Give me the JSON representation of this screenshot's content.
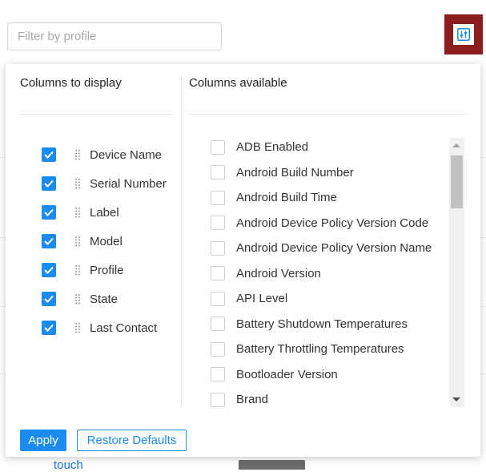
{
  "filter": {
    "placeholder": "Filter by profile"
  },
  "toolbar": {
    "column_settings_icon": "sliders-icon",
    "active_color": "#8c1d1f"
  },
  "background": {
    "link_text": "touch"
  },
  "panel": {
    "left_title": "Columns to display",
    "right_title": "Columns available",
    "selected_columns": [
      "Device Name",
      "Serial Number",
      "Label",
      "Model",
      "Profile",
      "State",
      "Last Contact"
    ],
    "available_columns": [
      "ADB Enabled",
      "Android Build Number",
      "Android Build Time",
      "Android Device Policy Version Code",
      "Android Device Policy Version Name",
      "Android Version",
      "API Level",
      "Battery Shutdown Temperatures",
      "Battery Throttling Temperatures",
      "Bootloader Version",
      "Brand"
    ],
    "apply_label": "Apply",
    "restore_label": "Restore Defaults",
    "accent_color": "#1a8cf0"
  }
}
